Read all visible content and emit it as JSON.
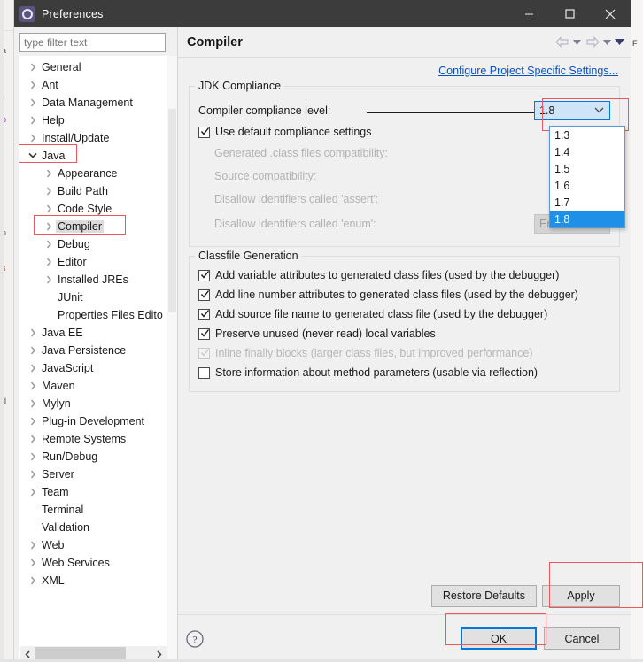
{
  "window": {
    "title": "Preferences",
    "icon": "eclipse-gear-icon",
    "minimize_label": "minimize-icon",
    "maximize_label": "maximize-icon",
    "close_label": "close-icon"
  },
  "filter": {
    "placeholder": "type filter text",
    "value": ""
  },
  "tree": {
    "items": [
      {
        "label": "General",
        "level": 0,
        "arrow": "collapsed",
        "selected": false
      },
      {
        "label": "Ant",
        "level": 0,
        "arrow": "collapsed",
        "selected": false
      },
      {
        "label": "Data Management",
        "level": 0,
        "arrow": "collapsed",
        "selected": false
      },
      {
        "label": "Help",
        "level": 0,
        "arrow": "collapsed",
        "selected": false
      },
      {
        "label": "Install/Update",
        "level": 0,
        "arrow": "collapsed",
        "selected": false
      },
      {
        "label": "Java",
        "level": 0,
        "arrow": "expanded",
        "selected": false
      },
      {
        "label": "Appearance",
        "level": 1,
        "arrow": "collapsed",
        "selected": false
      },
      {
        "label": "Build Path",
        "level": 1,
        "arrow": "collapsed",
        "selected": false
      },
      {
        "label": "Code Style",
        "level": 1,
        "arrow": "collapsed",
        "selected": false
      },
      {
        "label": "Compiler",
        "level": 1,
        "arrow": "collapsed",
        "selected": true
      },
      {
        "label": "Debug",
        "level": 1,
        "arrow": "collapsed",
        "selected": false
      },
      {
        "label": "Editor",
        "level": 1,
        "arrow": "collapsed",
        "selected": false
      },
      {
        "label": "Installed JREs",
        "level": 1,
        "arrow": "collapsed",
        "selected": false
      },
      {
        "label": "JUnit",
        "level": 1,
        "arrow": "none",
        "selected": false
      },
      {
        "label": "Properties Files Edito",
        "level": 1,
        "arrow": "none",
        "selected": false
      },
      {
        "label": "Java EE",
        "level": 0,
        "arrow": "collapsed",
        "selected": false
      },
      {
        "label": "Java Persistence",
        "level": 0,
        "arrow": "collapsed",
        "selected": false
      },
      {
        "label": "JavaScript",
        "level": 0,
        "arrow": "collapsed",
        "selected": false
      },
      {
        "label": "Maven",
        "level": 0,
        "arrow": "collapsed",
        "selected": false
      },
      {
        "label": "Mylyn",
        "level": 0,
        "arrow": "collapsed",
        "selected": false
      },
      {
        "label": "Plug-in Development",
        "level": 0,
        "arrow": "collapsed",
        "selected": false
      },
      {
        "label": "Remote Systems",
        "level": 0,
        "arrow": "collapsed",
        "selected": false
      },
      {
        "label": "Run/Debug",
        "level": 0,
        "arrow": "collapsed",
        "selected": false
      },
      {
        "label": "Server",
        "level": 0,
        "arrow": "collapsed",
        "selected": false
      },
      {
        "label": "Team",
        "level": 0,
        "arrow": "collapsed",
        "selected": false
      },
      {
        "label": "Terminal",
        "level": 0,
        "arrow": "none",
        "selected": false
      },
      {
        "label": "Validation",
        "level": 0,
        "arrow": "none",
        "selected": false
      },
      {
        "label": "Web",
        "level": 0,
        "arrow": "collapsed",
        "selected": false
      },
      {
        "label": "Web Services",
        "level": 0,
        "arrow": "collapsed",
        "selected": false
      },
      {
        "label": "XML",
        "level": 0,
        "arrow": "collapsed",
        "selected": false
      }
    ]
  },
  "page": {
    "title": "Compiler",
    "nav": {
      "back": "back-arrow-icon",
      "back_menu": "back-dropdown-icon",
      "forward": "forward-arrow-icon",
      "forward_menu": "forward-dropdown-icon",
      "view_menu": "view-menu-icon"
    },
    "project_link": "Configure Project Specific Settings..."
  },
  "jdk_compliance": {
    "title": "JDK Compliance",
    "compliance_level_label": "Compiler compliance level:",
    "compliance_level_value": "1.8",
    "compliance_options": [
      "1.3",
      "1.4",
      "1.5",
      "1.6",
      "1.7",
      "1.8"
    ],
    "compliance_selected": "1.8",
    "use_default_label": "Use default compliance settings",
    "use_default_checked": true,
    "generated_class_label": "Generated .class files compatibility:",
    "source_compat_label": "Source compatibility:",
    "disallow_assert_label": "Disallow identifiers called 'assert':",
    "disallow_enum_label": "Disallow identifiers called 'enum':",
    "disallow_enum_value": "Error"
  },
  "classfile_generation": {
    "title": "Classfile Generation",
    "options": [
      {
        "label": "Add variable attributes to generated class files (used by the debugger)",
        "checked": true,
        "disabled": false
      },
      {
        "label": "Add line number attributes to generated class files (used by the debugger)",
        "checked": true,
        "disabled": false
      },
      {
        "label": "Add source file name to generated class file (used by the debugger)",
        "checked": true,
        "disabled": false
      },
      {
        "label": "Preserve unused (never read) local variables",
        "checked": true,
        "disabled": false
      },
      {
        "label": "Inline finally blocks (larger class files, but improved performance)",
        "checked": true,
        "disabled": true
      },
      {
        "label": "Store information about method parameters (usable via reflection)",
        "checked": false,
        "disabled": false
      }
    ]
  },
  "buttons": {
    "restore_defaults": "Restore Defaults",
    "apply": "Apply",
    "ok": "OK",
    "cancel": "Cancel",
    "help": "help-icon"
  },
  "colors": {
    "titlebar": "#3c3c3c",
    "dialog_bg": "#f0f0f0",
    "link": "#0a53b5",
    "selection": "#1e90e8",
    "focus_border": "#0078d7",
    "annotation": "#e8595f"
  }
}
